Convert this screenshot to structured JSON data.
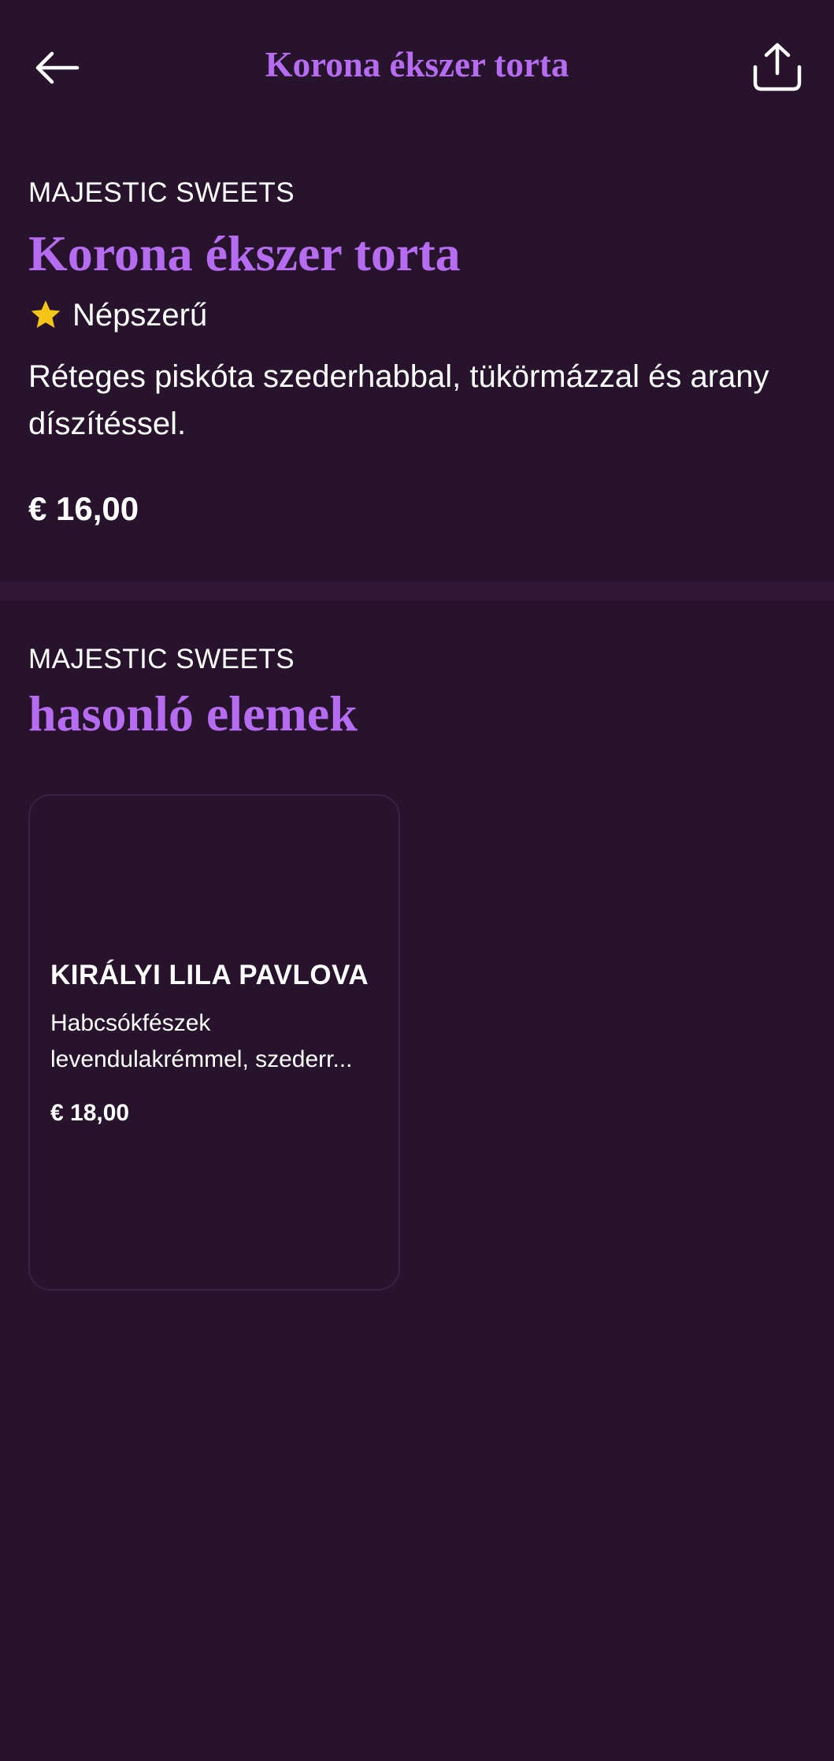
{
  "header": {
    "title": "Korona ékszer torta",
    "back_icon": "arrow-left-icon",
    "share_icon": "share-icon"
  },
  "product": {
    "brand": "MAJESTIC SWEETS",
    "title": "Korona ékszer torta",
    "popular_label": "Népszerű",
    "popular_icon": "star-icon",
    "description": "Réteges piskóta szederhabbal, tükörmázzal és arany díszítéssel.",
    "price": "€ 16,00"
  },
  "similar": {
    "brand": "MAJESTIC SWEETS",
    "title": "hasonló elemek",
    "items": [
      {
        "name": "KIRÁLYI LILA PAVLOVA",
        "description_line1": "Habcsókfészek",
        "description_line2": "levendulakrémmel, szederr...",
        "price": "€ 18,00"
      }
    ]
  },
  "colors": {
    "background": "#28132d",
    "accent": "#b56cf0",
    "star": "#f5c518",
    "text": "#ffffff"
  }
}
